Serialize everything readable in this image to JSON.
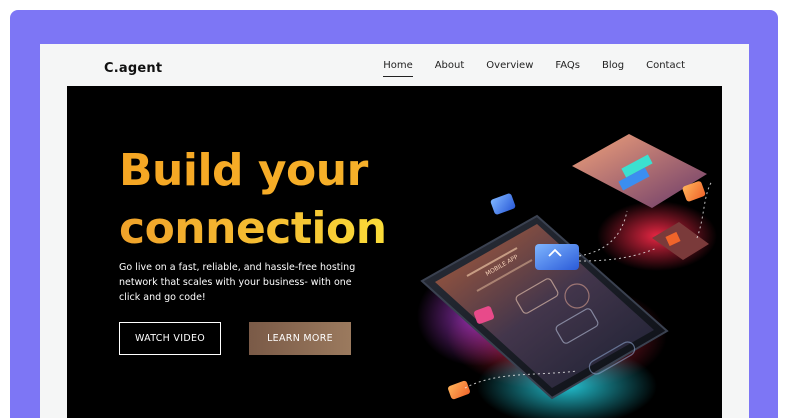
{
  "brand": {
    "logo": "C.agent"
  },
  "nav": {
    "items": [
      {
        "label": "Home",
        "active": true
      },
      {
        "label": "About",
        "active": false
      },
      {
        "label": "Overview",
        "active": false
      },
      {
        "label": "FAQs",
        "active": false
      },
      {
        "label": "Blog",
        "active": false
      },
      {
        "label": "Contact",
        "active": false
      }
    ]
  },
  "hero": {
    "headline_line1": "Build your",
    "headline_line2": "connection",
    "subtext": "Go live on a fast, reliable, and hassle-free hosting network that scales with your business- with one click and go code!",
    "watch_video_label": "WATCH VIDEO",
    "learn_more_label": "LEARN MORE",
    "illustration_label": "MOBILE APP"
  },
  "colors": {
    "frame": "#7d76f5",
    "accent_orange": "#f5a623",
    "accent_yellow": "#fde63a",
    "learn_button": "#8a6a52"
  }
}
